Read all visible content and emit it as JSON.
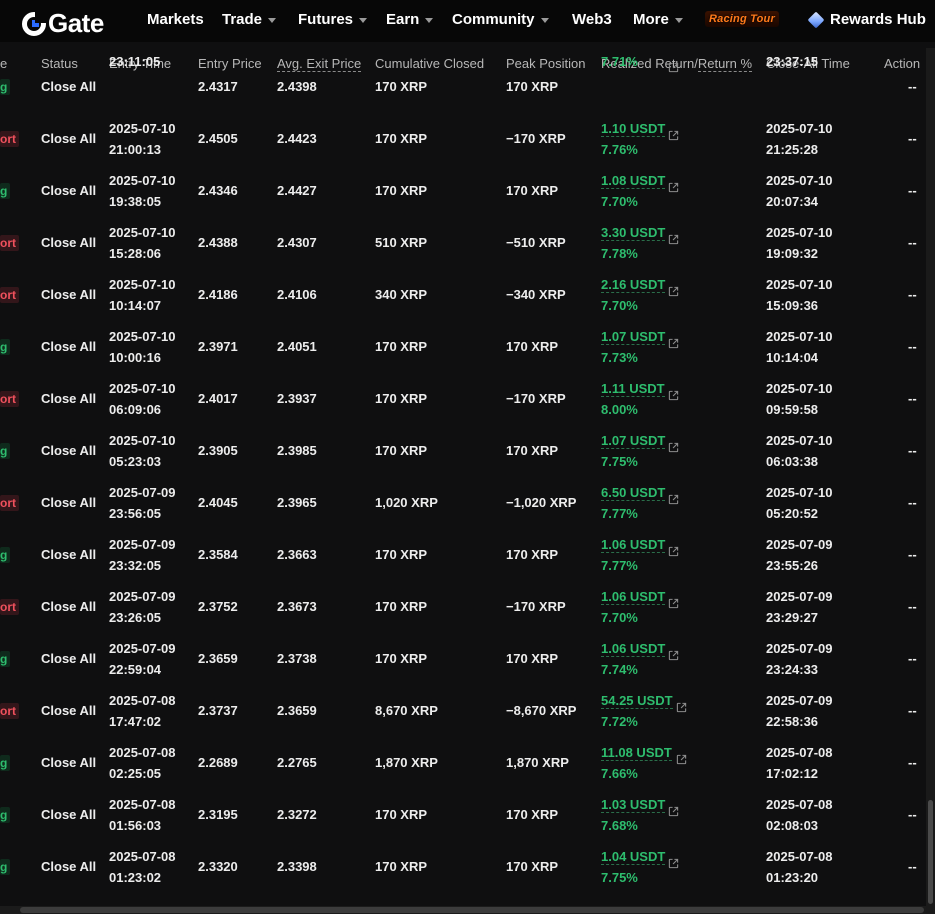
{
  "nav": {
    "logo": "Gate",
    "items": [
      {
        "label": "Markets",
        "caret": false
      },
      {
        "label": "Trade",
        "caret": true
      },
      {
        "label": "Futures",
        "caret": true
      },
      {
        "label": "Earn",
        "caret": true
      },
      {
        "label": "Community",
        "caret": true
      },
      {
        "label": "Web3",
        "caret": false
      },
      {
        "label": "More",
        "caret": true
      }
    ],
    "promo": "Racing Tour",
    "rewards": "Rewards Hub"
  },
  "table": {
    "headers": {
      "side": "e",
      "status": "Status",
      "entry_time": "Entry Time",
      "entry_price": "Entry Price",
      "avg_exit_price": "Avg. Exit Price",
      "cumulative_closed": "Cumulative Closed",
      "peak_position": "Peak Position",
      "realized_return": "Realized Return",
      "return_sep": "/",
      "return_pct": "Return %",
      "close_all_time": "Close-All Time",
      "action": "Action"
    },
    "rows": [
      {
        "side": "g",
        "side_type": "long",
        "status": "Close All",
        "entry_date": "",
        "entry_time": "23:11:05",
        "entry_price": "2.4317",
        "avg_exit": "2.4398",
        "cum_closed": "170 XRP",
        "peak": "170 XRP",
        "usdt": "",
        "pct": "7.71%",
        "close_date": "",
        "close_time": "23:37:15",
        "action": "--"
      },
      {
        "side": "ort",
        "side_type": "short",
        "status": "Close All",
        "entry_date": "2025-07-10",
        "entry_time": "21:00:13",
        "entry_price": "2.4505",
        "avg_exit": "2.4423",
        "cum_closed": "170 XRP",
        "peak": "−170 XRP",
        "usdt": "1.10 USDT",
        "pct": "7.76%",
        "close_date": "2025-07-10",
        "close_time": "21:25:28",
        "action": "--"
      },
      {
        "side": "g",
        "side_type": "long",
        "status": "Close All",
        "entry_date": "2025-07-10",
        "entry_time": "19:38:05",
        "entry_price": "2.4346",
        "avg_exit": "2.4427",
        "cum_closed": "170 XRP",
        "peak": "170 XRP",
        "usdt": "1.08 USDT",
        "pct": "7.70%",
        "close_date": "2025-07-10",
        "close_time": "20:07:34",
        "action": "--"
      },
      {
        "side": "ort",
        "side_type": "short",
        "status": "Close All",
        "entry_date": "2025-07-10",
        "entry_time": "15:28:06",
        "entry_price": "2.4388",
        "avg_exit": "2.4307",
        "cum_closed": "510 XRP",
        "peak": "−510 XRP",
        "usdt": "3.30 USDT",
        "pct": "7.78%",
        "close_date": "2025-07-10",
        "close_time": "19:09:32",
        "action": "--"
      },
      {
        "side": "ort",
        "side_type": "short",
        "status": "Close All",
        "entry_date": "2025-07-10",
        "entry_time": "10:14:07",
        "entry_price": "2.4186",
        "avg_exit": "2.4106",
        "cum_closed": "340 XRP",
        "peak": "−340 XRP",
        "usdt": "2.16 USDT",
        "pct": "7.70%",
        "close_date": "2025-07-10",
        "close_time": "15:09:36",
        "action": "--"
      },
      {
        "side": "g",
        "side_type": "long",
        "status": "Close All",
        "entry_date": "2025-07-10",
        "entry_time": "10:00:16",
        "entry_price": "2.3971",
        "avg_exit": "2.4051",
        "cum_closed": "170 XRP",
        "peak": "170 XRP",
        "usdt": "1.07 USDT",
        "pct": "7.73%",
        "close_date": "2025-07-10",
        "close_time": "10:14:04",
        "action": "--"
      },
      {
        "side": "ort",
        "side_type": "short",
        "status": "Close All",
        "entry_date": "2025-07-10",
        "entry_time": "06:09:06",
        "entry_price": "2.4017",
        "avg_exit": "2.3937",
        "cum_closed": "170 XRP",
        "peak": "−170 XRP",
        "usdt": "1.11 USDT",
        "pct": "8.00%",
        "close_date": "2025-07-10",
        "close_time": "09:59:58",
        "action": "--"
      },
      {
        "side": "g",
        "side_type": "long",
        "status": "Close All",
        "entry_date": "2025-07-10",
        "entry_time": "05:23:03",
        "entry_price": "2.3905",
        "avg_exit": "2.3985",
        "cum_closed": "170 XRP",
        "peak": "170 XRP",
        "usdt": "1.07 USDT",
        "pct": "7.75%",
        "close_date": "2025-07-10",
        "close_time": "06:03:38",
        "action": "--"
      },
      {
        "side": "ort",
        "side_type": "short",
        "status": "Close All",
        "entry_date": "2025-07-09",
        "entry_time": "23:56:05",
        "entry_price": "2.4045",
        "avg_exit": "2.3965",
        "cum_closed": "1,020 XRP",
        "peak": "−1,020 XRP",
        "usdt": "6.50 USDT",
        "pct": "7.77%",
        "close_date": "2025-07-10",
        "close_time": "05:20:52",
        "action": "--"
      },
      {
        "side": "g",
        "side_type": "long",
        "status": "Close All",
        "entry_date": "2025-07-09",
        "entry_time": "23:32:05",
        "entry_price": "2.3584",
        "avg_exit": "2.3663",
        "cum_closed": "170 XRP",
        "peak": "170 XRP",
        "usdt": "1.06 USDT",
        "pct": "7.77%",
        "close_date": "2025-07-09",
        "close_time": "23:55:26",
        "action": "--"
      },
      {
        "side": "ort",
        "side_type": "short",
        "status": "Close All",
        "entry_date": "2025-07-09",
        "entry_time": "23:26:05",
        "entry_price": "2.3752",
        "avg_exit": "2.3673",
        "cum_closed": "170 XRP",
        "peak": "−170 XRP",
        "usdt": "1.06 USDT",
        "pct": "7.70%",
        "close_date": "2025-07-09",
        "close_time": "23:29:27",
        "action": "--"
      },
      {
        "side": "g",
        "side_type": "long",
        "status": "Close All",
        "entry_date": "2025-07-09",
        "entry_time": "22:59:04",
        "entry_price": "2.3659",
        "avg_exit": "2.3738",
        "cum_closed": "170 XRP",
        "peak": "170 XRP",
        "usdt": "1.06 USDT",
        "pct": "7.74%",
        "close_date": "2025-07-09",
        "close_time": "23:24:33",
        "action": "--"
      },
      {
        "side": "ort",
        "side_type": "short",
        "status": "Close All",
        "entry_date": "2025-07-08",
        "entry_time": "17:47:02",
        "entry_price": "2.3737",
        "avg_exit": "2.3659",
        "cum_closed": "8,670 XRP",
        "peak": "−8,670 XRP",
        "usdt": "54.25 USDT",
        "pct": "7.72%",
        "close_date": "2025-07-09",
        "close_time": "22:58:36",
        "action": "--"
      },
      {
        "side": "g",
        "side_type": "long",
        "status": "Close All",
        "entry_date": "2025-07-08",
        "entry_time": "02:25:05",
        "entry_price": "2.2689",
        "avg_exit": "2.2765",
        "cum_closed": "1,870 XRP",
        "peak": "1,870 XRP",
        "usdt": "11.08 USDT",
        "pct": "7.66%",
        "close_date": "2025-07-08",
        "close_time": "17:02:12",
        "action": "--"
      },
      {
        "side": "g",
        "side_type": "long",
        "status": "Close All",
        "entry_date": "2025-07-08",
        "entry_time": "01:56:03",
        "entry_price": "2.3195",
        "avg_exit": "2.3272",
        "cum_closed": "170 XRP",
        "peak": "170 XRP",
        "usdt": "1.03 USDT",
        "pct": "7.68%",
        "close_date": "2025-07-08",
        "close_time": "02:08:03",
        "action": "--"
      },
      {
        "side": "g",
        "side_type": "long",
        "status": "Close All",
        "entry_date": "2025-07-08",
        "entry_time": "01:23:02",
        "entry_price": "2.3320",
        "avg_exit": "2.3398",
        "cum_closed": "170 XRP",
        "peak": "170 XRP",
        "usdt": "1.04 USDT",
        "pct": "7.75%",
        "close_date": "2025-07-08",
        "close_time": "01:23:20",
        "action": "--"
      }
    ]
  },
  "colors": {
    "long": "#2ebd6e",
    "short": "#f0515d",
    "background": "#0f0f10"
  }
}
